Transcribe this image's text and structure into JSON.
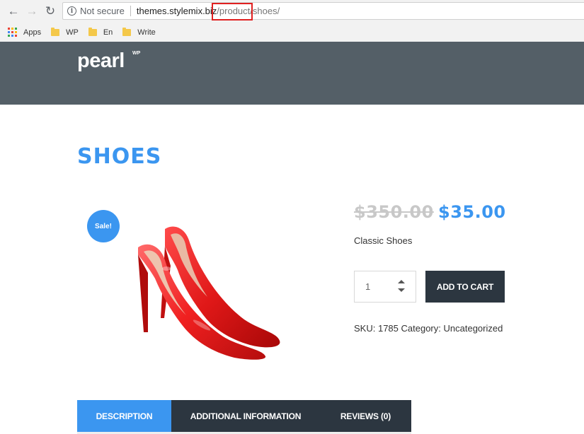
{
  "browser": {
    "nav": {
      "back_icon": "arrow-left-icon",
      "forward_icon": "arrow-right-icon",
      "reload_icon": "reload-icon",
      "back_glyph": "←",
      "forward_glyph": "→",
      "reload_glyph": "↻"
    },
    "address": {
      "security_icon": "info-icon",
      "security_glyph": "i",
      "security_text": "Not secure",
      "domain": "themes.stylemix.biz",
      "path_highlighted": "/product/",
      "path_rest": "shoes/"
    },
    "bookmarks": [
      {
        "label": "Apps",
        "icon": "apps-grid-icon"
      },
      {
        "label": "WP",
        "icon": "folder-icon"
      },
      {
        "label": "En",
        "icon": "folder-icon"
      },
      {
        "label": "Write",
        "icon": "folder-icon"
      }
    ]
  },
  "site": {
    "logo": "pearl",
    "logo_sup": "WP",
    "header_color": "#545f67"
  },
  "product": {
    "title": "SHOES",
    "badge": "Sale!",
    "price_old": "$350.00",
    "price_new": "$35.00",
    "short_description": "Classic Shoes",
    "quantity": "1",
    "add_to_cart": "ADD TO CART",
    "sku_label": "SKU:",
    "sku_value": "1785",
    "category_label": "Category:",
    "category_value": "Uncategorized",
    "accent_color": "#3b96f0",
    "dark_color": "#2c3640"
  },
  "tabs": [
    {
      "label": "DESCRIPTION",
      "active": true
    },
    {
      "label": "ADDITIONAL INFORMATION",
      "active": false
    },
    {
      "label": "REVIEWS (0)",
      "active": false
    }
  ]
}
